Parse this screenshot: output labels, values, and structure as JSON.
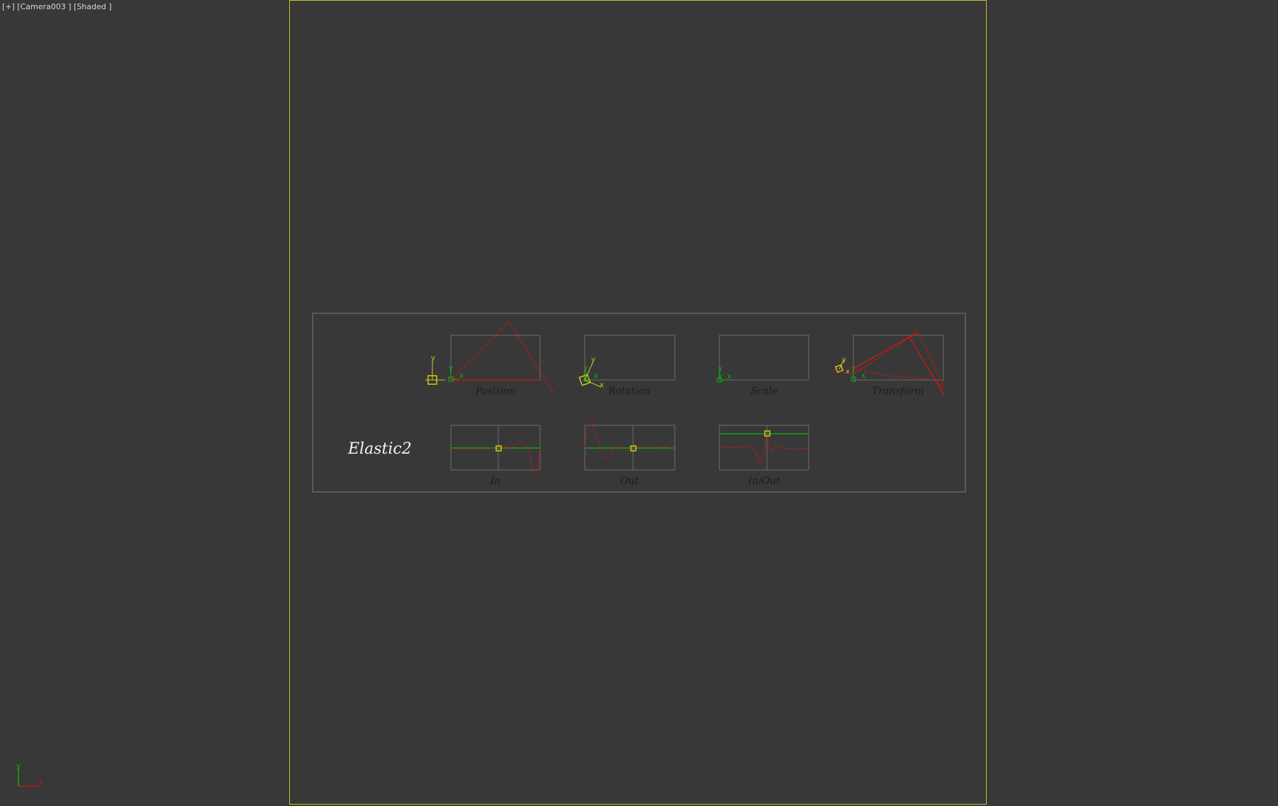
{
  "viewport": {
    "label": "[+] [Camera003 ] [Shaded ]",
    "frame_color": "#c9c12a",
    "background": "#383838"
  },
  "board": {
    "title": "Elastic2",
    "row1": {
      "position_label": "Position",
      "rotation_label": "Rotation",
      "scale_label": "Scale",
      "transform_label": "Transform"
    },
    "row2": {
      "in_label": "In",
      "out_label": "Out",
      "inout_label": "In/Out"
    }
  },
  "gizmo": {
    "x_label": "x",
    "y_label": "y"
  },
  "colors": {
    "curve": "#d21414",
    "track": "#0fb60f",
    "key": "#d4c81c",
    "box_border": "#6b6b6b"
  },
  "icons": [
    "world-axis-icon",
    "position-gizmo-icon",
    "rotation-gizmo-icon",
    "scale-gizmo-icon",
    "transform-gizmo-icon"
  ]
}
